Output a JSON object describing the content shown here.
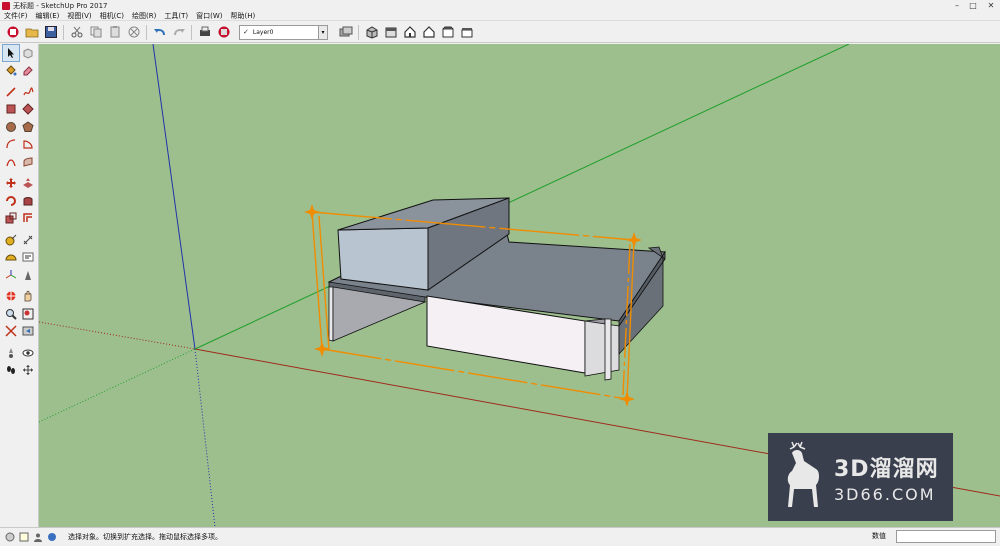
{
  "window": {
    "title": "无标题 - SketchUp Pro 2017",
    "controls": [
      "minimize-icon",
      "maximize-icon",
      "close-icon"
    ]
  },
  "menu": {
    "items": [
      "文件(F)",
      "编辑(E)",
      "视图(V)",
      "相机(C)",
      "绘图(R)",
      "工具(T)",
      "窗口(W)",
      "帮助(H)"
    ]
  },
  "toolbar": {
    "icons_left": [
      "get-started-icon",
      "open-icon",
      "save-icon",
      "cut-icon",
      "copy-icon",
      "paste-icon",
      "erase-icon",
      "undo-icon",
      "redo-icon",
      "print-icon",
      "model-info-icon"
    ],
    "layer": {
      "check": "✓",
      "name": "Layer0"
    },
    "icons_right": [
      "layer-manager-icon",
      "iso-view-icon",
      "top-view-icon",
      "front-view-icon",
      "right-view-icon",
      "back-view-icon",
      "left-view-icon"
    ]
  },
  "left_toolbar": {
    "icons": [
      "select-icon",
      "make-component-icon",
      "paint-bucket-icon",
      "eraser-icon",
      "line-icon",
      "freehand-icon",
      "rectangle-icon",
      "rotated-rectangle-icon",
      "circle-icon",
      "polygon-icon",
      "arc-icon",
      "pie-icon",
      "two-point-arc-icon",
      "three-point-arc-icon",
      "move-icon",
      "push-pull-icon",
      "rotate-icon",
      "follow-me-icon",
      "scale-icon",
      "offset-icon",
      "tape-measure-icon",
      "dimension-icon",
      "protractor-icon",
      "text-icon",
      "axes-icon",
      "3d-text-icon",
      "orbit-icon",
      "pan-icon",
      "zoom-icon",
      "zoom-window-icon",
      "zoom-extents-icon",
      "previous-icon",
      "position-camera-icon",
      "look-around-icon",
      "walk-icon",
      "section-plane-icon"
    ]
  },
  "watermark": {
    "line1": "3D溜溜网",
    "line2": "3D66.COM"
  },
  "status": {
    "message": "选择对象。切换到扩充选择。拖动鼠标选择多项。",
    "measure_label": "数值",
    "measure_value": ""
  },
  "colors": {
    "viewport_bg": "#9dbf8e",
    "red_axis": "#9e2a1a",
    "green_axis": "#1f9e2a",
    "blue_axis": "#2233aa",
    "selection": "#f08c00"
  }
}
